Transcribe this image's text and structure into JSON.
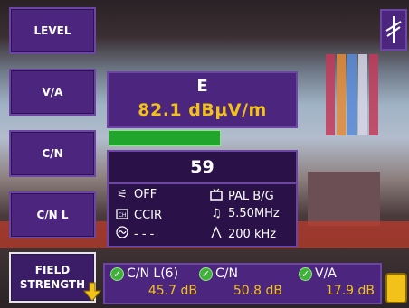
{
  "menu": {
    "items": [
      {
        "label": "LEVEL"
      },
      {
        "label": "V/A"
      },
      {
        "label": "C/N"
      },
      {
        "label": "C/N L"
      },
      {
        "label": "FIELD\nSTRENGTH",
        "line1": "FIELD",
        "line2": "STRENGTH",
        "selected": true
      }
    ]
  },
  "channel": {
    "letter": "E",
    "level": "82.1 dBµV/m",
    "level_fraction": 0.6,
    "number": "59"
  },
  "info": {
    "filter": "OFF",
    "tv_standard": "PAL B/G",
    "channel_plan": "CCIR",
    "audio_carrier": "5.50MHz",
    "colour_system": "- - -",
    "bandwidth": "200 kHz"
  },
  "measurements": [
    {
      "label": "C/N L(6)",
      "value": "45.7 dB"
    },
    {
      "label": "C/N",
      "value": "50.8 dB"
    },
    {
      "label": "V/A",
      "value": "17.9 dB"
    }
  ],
  "icons": {
    "corner": "antenna-icon",
    "scroll": "scroll-down-arrow-icon",
    "filter": "filter-icon",
    "tv": "tv-icon",
    "channel_plan": "channel-plan-icon",
    "audio": "music-note-icon",
    "colour": "colour-system-icon",
    "bandwidth": "bandwidth-icon",
    "check": "check-icon"
  },
  "colors": {
    "panel": "#4b257e",
    "value_yellow": "#f2c21a",
    "bar_green": "#22a52c"
  }
}
